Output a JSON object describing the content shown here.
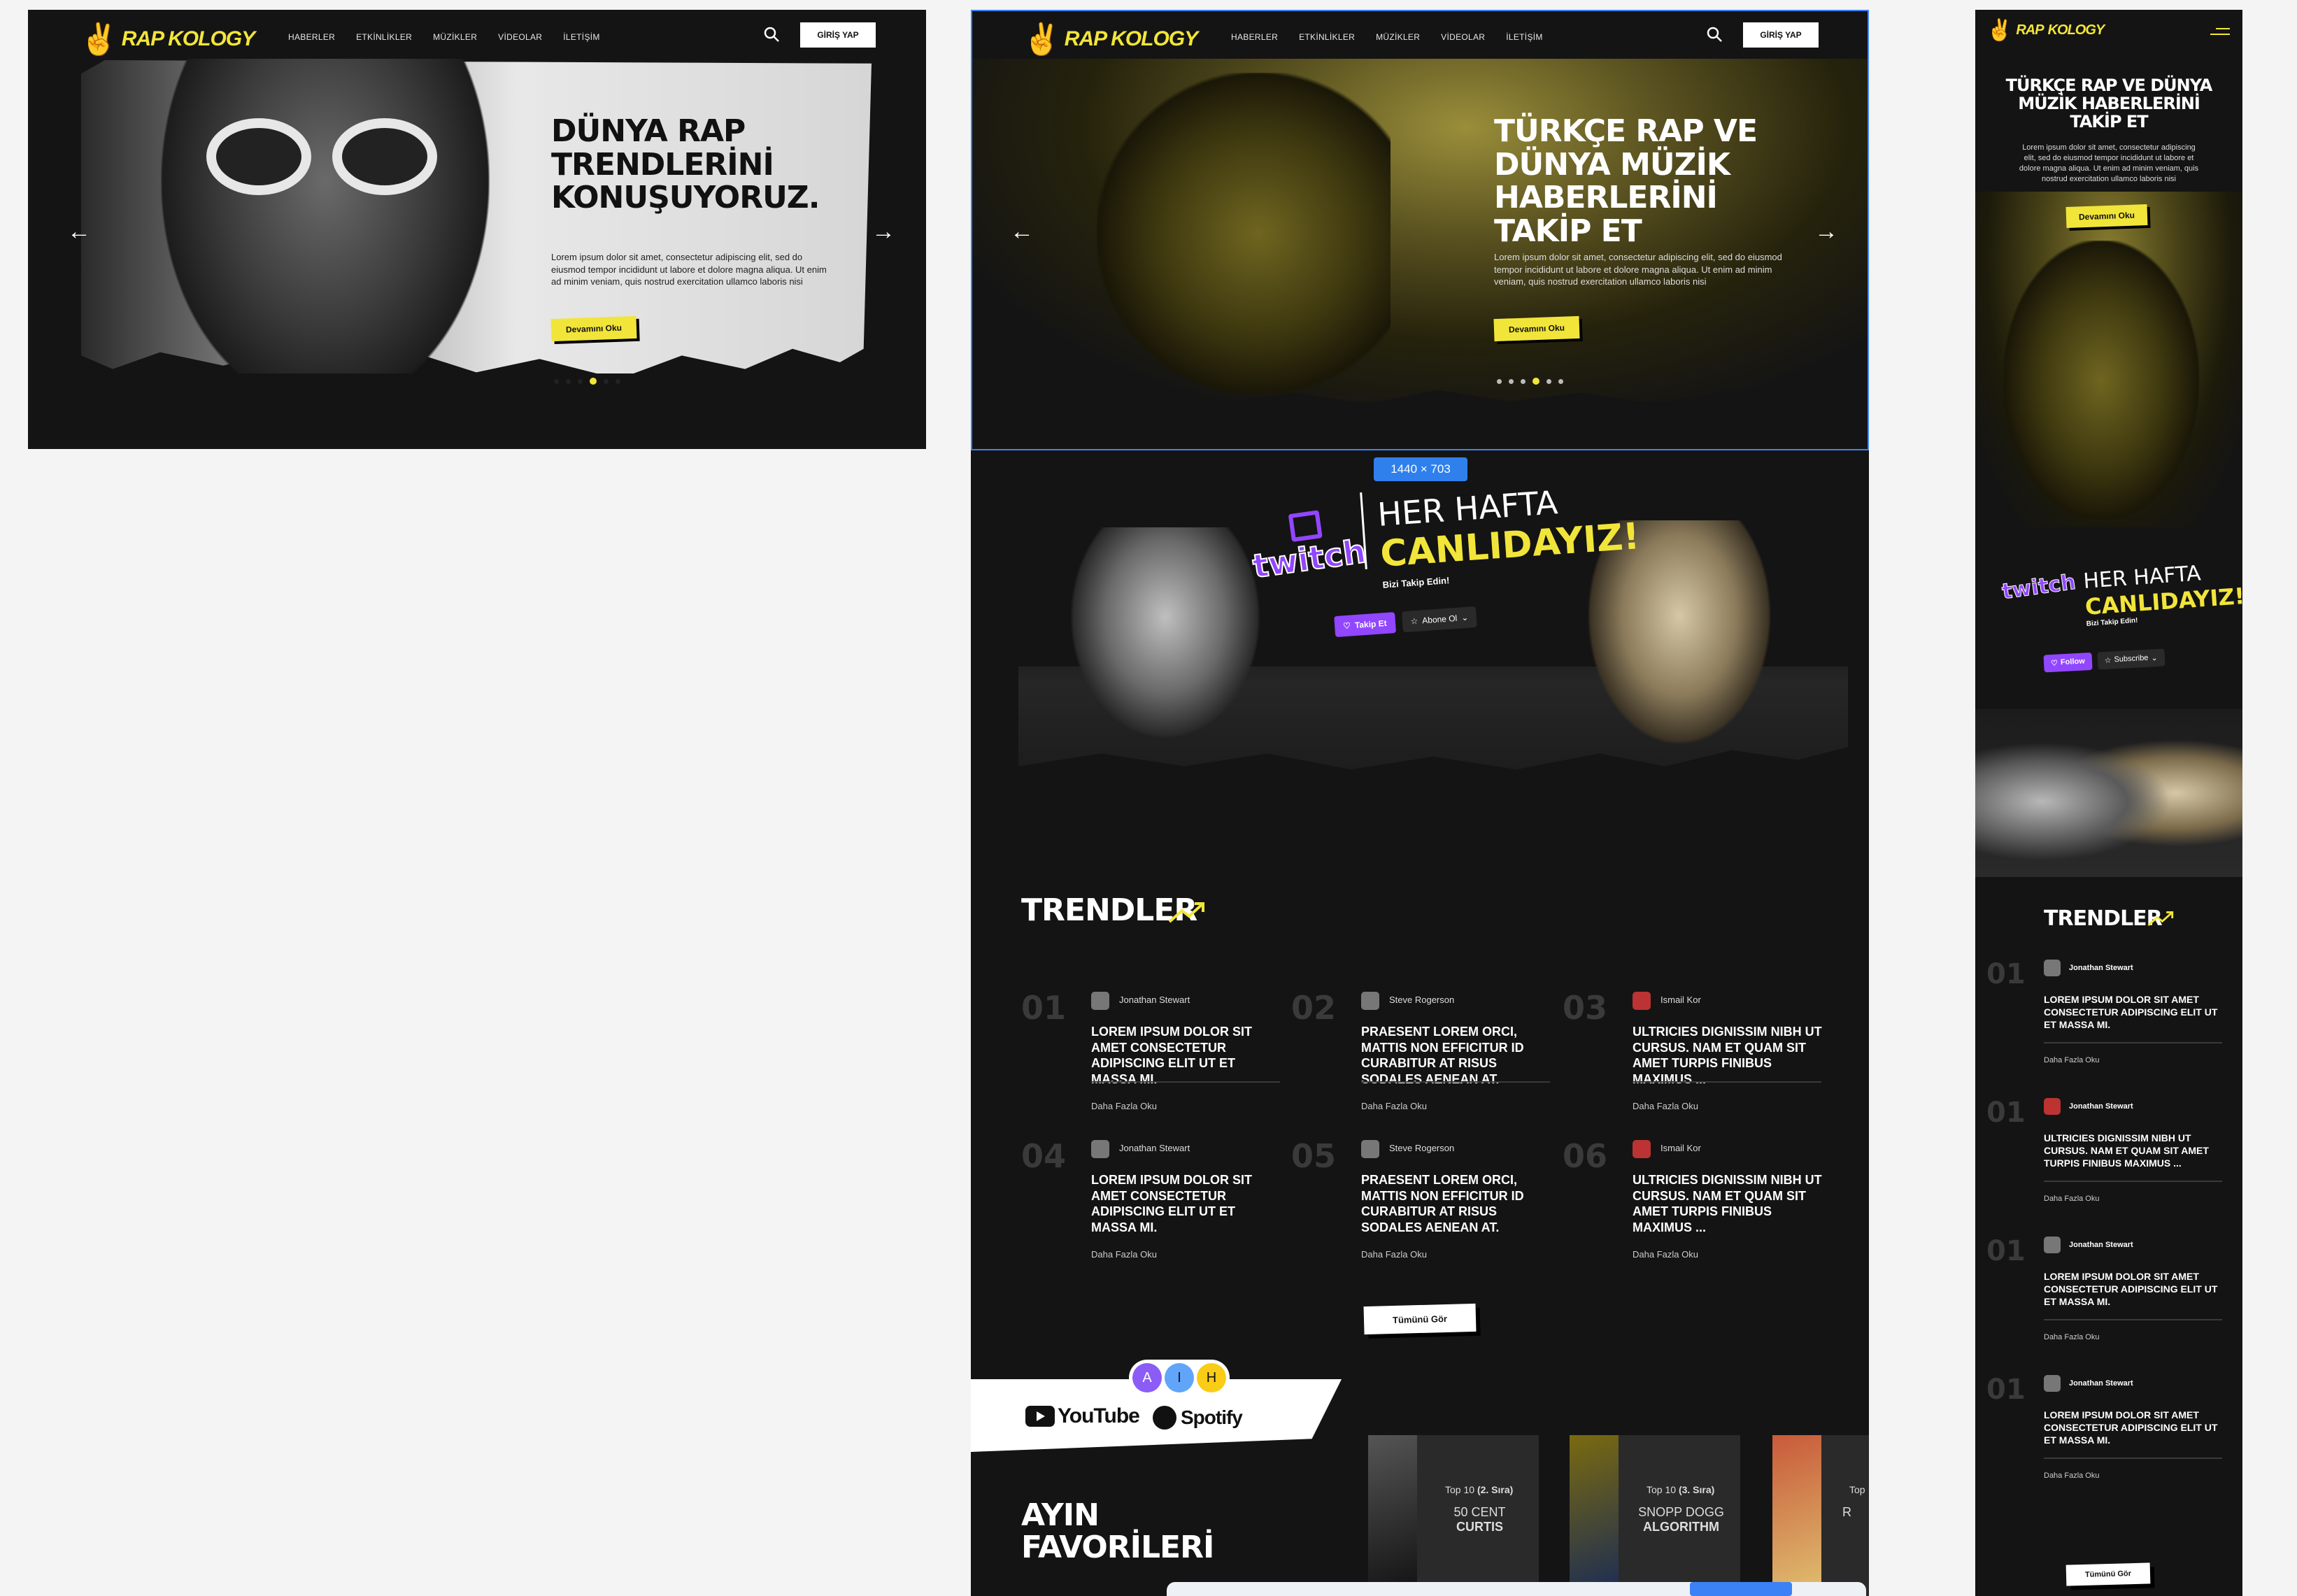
{
  "brand": {
    "logo_text_a": "RAP",
    "logo_text_b": "KOLOGY"
  },
  "nav": [
    "HABERLER",
    "ETKİNLİKLER",
    "MÜZİKLER",
    "VİDEOLAR",
    "İLETİŞİM"
  ],
  "login_label": "GİRİŞ YAP",
  "hero_left": {
    "title": "DÜNYA RAP TRENDLERİNİ KONUŞUYORUZ.",
    "desc": "Lorem ipsum dolor sit amet, consectetur adipiscing elit, sed do eiusmod tempor incididunt ut labore et dolore magna aliqua. Ut enim ad minim veniam, quis nostrud exercitation ullamco laboris nisi",
    "cta": "Devamını Oku"
  },
  "hero_main": {
    "title": "TÜRKÇE RAP VE DÜNYA MÜZİK HABERLERİNİ TAKİP ET",
    "desc": "Lorem ipsum dolor sit amet, consectetur adipiscing elit, sed do eiusmod tempor incididunt ut labore et dolore magna aliqua. Ut enim ad minim veniam, quis nostrud exercitation ullamco laboris nisi",
    "cta": "Devamını Oku"
  },
  "hero_mobile": {
    "title": "TÜRKÇE RAP VE DÜNYA MÜZİK HABERLERİNİ TAKİP ET",
    "desc": "Lorem ipsum dolor sit amet, consectetur adipiscing elit, sed do eiusmod tempor incididunt ut labore et dolore magna aliqua. Ut enim ad minim veniam, quis nostrud exercitation ullamco laboris nisi",
    "cta": "Devamını Oku"
  },
  "size_badge": "1440 × 703",
  "twitch": {
    "wordmark": "twitch",
    "heading_a": "HER HAFTA",
    "heading_b": "CANLIDAYIZ!",
    "sub": "Bizi Takip Edin!",
    "follow": "Takip Et",
    "subscribe": "Abone Ol",
    "follow_mobile": "Follow",
    "subscribe_mobile": "Subscribe"
  },
  "trends": {
    "title": "TRENDLER",
    "items": [
      {
        "num": "01",
        "author": "Jonathan Stewart",
        "title": "LOREM IPSUM DOLOR SIT AMET CONSECTETUR ADIPISCING ELIT UT ET MASSA MI.",
        "more": "Daha Fazla Oku"
      },
      {
        "num": "02",
        "author": "Steve Rogerson",
        "title": "PRAESENT LOREM ORCI, MATTIS NON EFFICITUR ID CURABITUR AT RISUS SODALES AENEAN AT.",
        "more": "Daha Fazla Oku"
      },
      {
        "num": "03",
        "author": "Ismail Kor",
        "title": "ULTRICIES DIGNISSIM NIBH UT CURSUS. NAM ET QUAM SIT AMET TURPIS FINIBUS MAXIMUS ...",
        "more": "Daha Fazla Oku"
      },
      {
        "num": "04",
        "author": "Jonathan Stewart",
        "title": "LOREM IPSUM DOLOR SIT AMET CONSECTETUR ADIPISCING ELIT UT ET MASSA MI.",
        "more": "Daha Fazla Oku"
      },
      {
        "num": "05",
        "author": "Steve Rogerson",
        "title": "PRAESENT LOREM ORCI, MATTIS NON EFFICITUR ID CURABITUR AT RISUS SODALES AENEAN AT.",
        "more": "Daha Fazla Oku"
      },
      {
        "num": "06",
        "author": "Ismail Kor",
        "title": "ULTRICIES DIGNISSIM NIBH UT CURSUS. NAM ET QUAM SIT AMET TURPIS FINIBUS MAXIMUS ...",
        "more": "Daha Fazla Oku"
      }
    ],
    "all_label": "Tümünü Gör"
  },
  "mobile_trends": [
    {
      "num": "01",
      "author": "Jonathan Stewart",
      "title": "LOREM IPSUM DOLOR SIT AMET CONSECTETUR ADIPISCING ELIT UT ET MASSA MI.",
      "more": "Daha Fazla Oku"
    },
    {
      "num": "01",
      "author": "Jonathan Stewart",
      "title": "ULTRICIES DIGNISSIM NIBH UT CURSUS. NAM ET QUAM SIT AMET TURPIS FINIBUS MAXIMUS ...",
      "more": "Daha Fazla Oku"
    },
    {
      "num": "01",
      "author": "Jonathan Stewart",
      "title": "LOREM IPSUM DOLOR SIT AMET CONSECTETUR ADIPISCING ELIT UT ET MASSA MI.",
      "more": "Daha Fazla Oku"
    },
    {
      "num": "01",
      "author": "Jonathan Stewart",
      "title": "LOREM IPSUM DOLOR SIT AMET CONSECTETUR ADIPISCING ELIT UT ET MASSA MI.",
      "more": "Daha Fazla Oku"
    }
  ],
  "platforms": {
    "youtube": "YouTube",
    "spotify": "Spotify"
  },
  "avatars": [
    "A",
    "I",
    "H"
  ],
  "favorites": {
    "title_a": "AYIN",
    "title_b": "FAVORİLERİ",
    "cards": [
      {
        "rank_a": "Top 10 ",
        "rank_b": "(2. Sıra)",
        "artist_a": "50 CENT",
        "artist_b": "CURTIS"
      },
      {
        "rank_a": "Top 10 ",
        "rank_b": "(3. Sıra)",
        "artist_a": "SNOPP DOGG",
        "artist_b": "ALGORITHM"
      },
      {
        "rank_a": "Top",
        "rank_b": "",
        "artist_a": "R",
        "artist_b": ""
      }
    ]
  },
  "colors": {
    "accent": "#f2e53a",
    "twitch": "#9146ff",
    "bg": "#141414"
  }
}
